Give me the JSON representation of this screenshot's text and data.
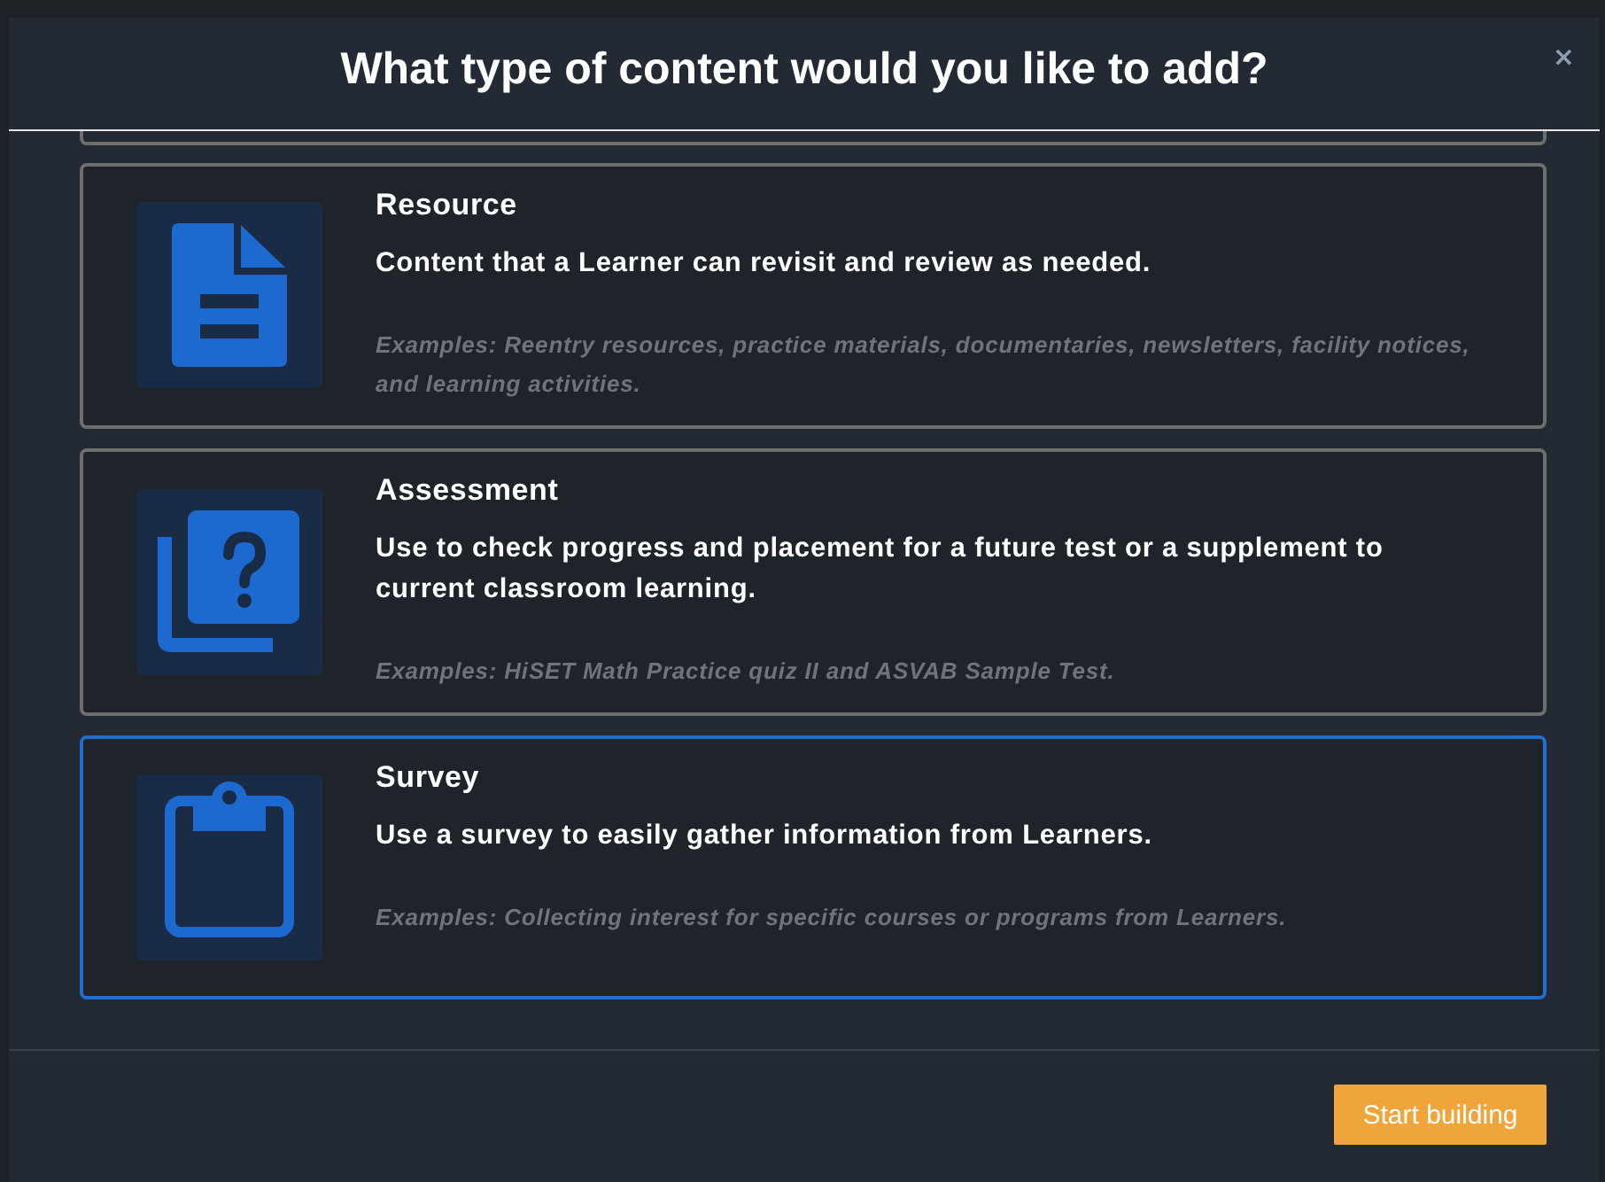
{
  "dialog": {
    "title": "What type of content would you like to add?",
    "close_label": "×"
  },
  "options": [
    {
      "kind": "resource",
      "title": "Resource",
      "description": "Content that a Learner can revisit and review as needed.",
      "examples": "Examples: Reentry resources, practice materials, documentaries, newsletters, facility notices, and learning activities.",
      "selected": false
    },
    {
      "kind": "assessment",
      "title": "Assessment",
      "description": "Use to check progress and placement for a future test or a supplement to current classroom learning.",
      "examples": "Examples: HiSET Math Practice quiz II and ASVAB Sample Test.",
      "selected": false
    },
    {
      "kind": "survey",
      "title": "Survey",
      "description": "Use a survey to easily gather information from Learners.",
      "examples": "Examples: Collecting interest for specific courses or programs from Learners.",
      "selected": true
    }
  ],
  "footer": {
    "primary_button": "Start building"
  }
}
